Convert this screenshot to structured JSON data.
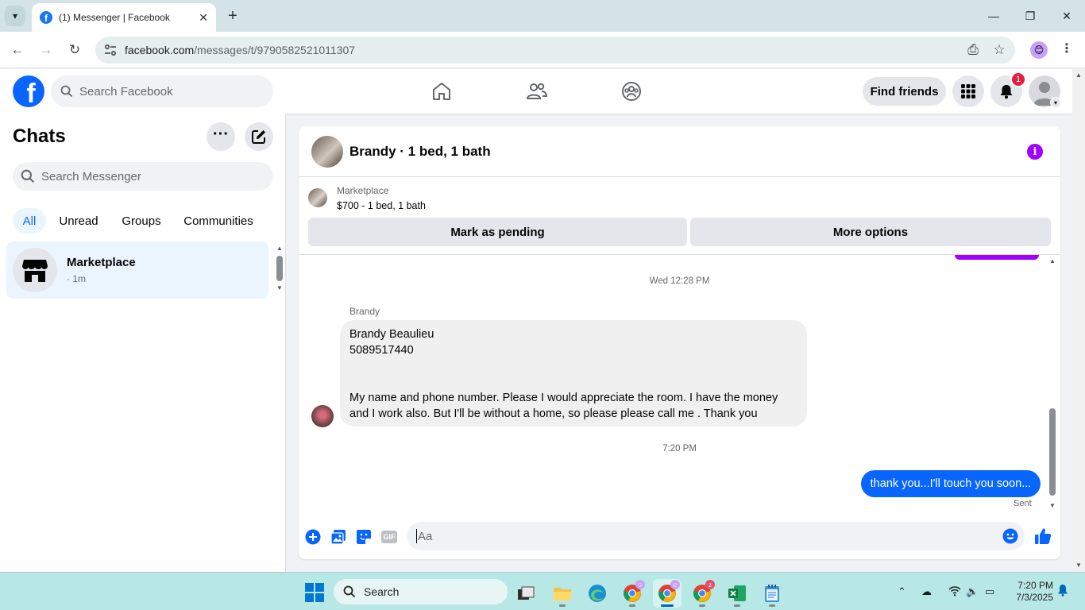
{
  "browser": {
    "tab_title": "(1) Messenger | Facebook",
    "url_host": "facebook.com",
    "url_path": "/messages/t/9790582521011307"
  },
  "fb_header": {
    "search_placeholder": "Search Facebook",
    "find_friends_label": "Find friends",
    "notification_count": "1"
  },
  "sidebar": {
    "title": "Chats",
    "search_placeholder": "Search Messenger",
    "filters": [
      "All",
      "Unread",
      "Groups",
      "Communities"
    ],
    "chats": [
      {
        "name": "Marketplace",
        "time": "· 1m"
      }
    ]
  },
  "conversation": {
    "title": "Brandy · 1 bed, 1 bath",
    "marketplace_label": "Marketplace",
    "listing": "$700 - 1 bed, 1 bath",
    "mark_pending_label": "Mark as pending",
    "more_options_label": "More options",
    "messages": {
      "stamp_1": "Wed 12:28 PM",
      "sender": "Brandy",
      "incoming_line_1": "Brandy Beaulieu",
      "incoming_line_2": "5089517440",
      "incoming_line_3": "My name and phone number. Please  I would appreciate the room. I have the money",
      "incoming_line_4": "and I work also. But I'll be without a home, so please please call me . Thank you",
      "stamp_2": "7:20 PM",
      "outgoing": "thank you...I'll touch you soon...",
      "status": "Sent"
    },
    "composer_placeholder": "Aa",
    "gif_label": "GIF"
  },
  "taskbar": {
    "search_label": "Search",
    "time": "7:20 PM",
    "date": "7/3/2025"
  },
  "colors": {
    "fb_blue": "#0866ff",
    "accent_purple": "#a100ff",
    "notification_red": "#e41e3f"
  }
}
